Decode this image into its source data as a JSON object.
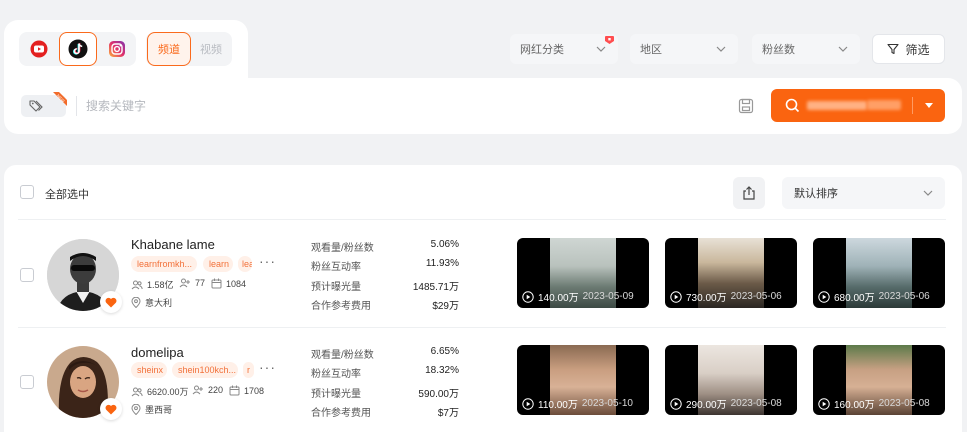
{
  "platforms": [
    {
      "name": "YouTube",
      "icon": "youtube-icon",
      "active": false
    },
    {
      "name": "TikTok",
      "icon": "tiktok-icon",
      "active": true
    },
    {
      "name": "Instagram",
      "icon": "instagram-icon",
      "active": false
    }
  ],
  "channel_tabs": {
    "channel": "频道",
    "video": "视频",
    "active": "channel"
  },
  "filters": {
    "category": "网红分类",
    "region": "地区",
    "fans": "粉丝数",
    "filter_button": "筛选"
  },
  "search": {
    "placeholder": "搜索关键字",
    "tag_badge": "NEW"
  },
  "colors": {
    "accent": "#fa6410",
    "tag_text": "#f2713a",
    "tag_bg": "#fff0e8"
  },
  "results": {
    "select_all": "全部选中",
    "sort": "默认排序",
    "metric_labels": [
      "观看量/粉丝数",
      "粉丝互动率",
      "预计曝光量",
      "合作参考费用"
    ],
    "influencers": [
      {
        "name": "Khabane lame",
        "tags": [
          "learnfromkh...",
          "learn",
          "lea"
        ],
        "fans": "1.58亿",
        "following": "77",
        "posts": "1084",
        "country": "意大利",
        "metrics": [
          "5.06%",
          "11.93%",
          "1485.71万",
          "$29万"
        ],
        "favorited": true,
        "videos": [
          {
            "views": "140.00万",
            "date": "2023-05-09"
          },
          {
            "views": "730.00万",
            "date": "2023-05-06"
          },
          {
            "views": "680.00万",
            "date": "2023-05-06"
          }
        ]
      },
      {
        "name": "domelipa",
        "tags": [
          "sheinx",
          "shein100kch...",
          "r"
        ],
        "fans": "6620.00万",
        "following": "220",
        "posts": "1708",
        "country": "墨西哥",
        "metrics": [
          "6.65%",
          "18.32%",
          "590.00万",
          "$7万"
        ],
        "favorited": true,
        "videos": [
          {
            "views": "110.00万",
            "date": "2023-05-10"
          },
          {
            "views": "290.00万",
            "date": "2023-05-08"
          },
          {
            "views": "160.00万",
            "date": "2023-05-08"
          }
        ]
      }
    ]
  }
}
